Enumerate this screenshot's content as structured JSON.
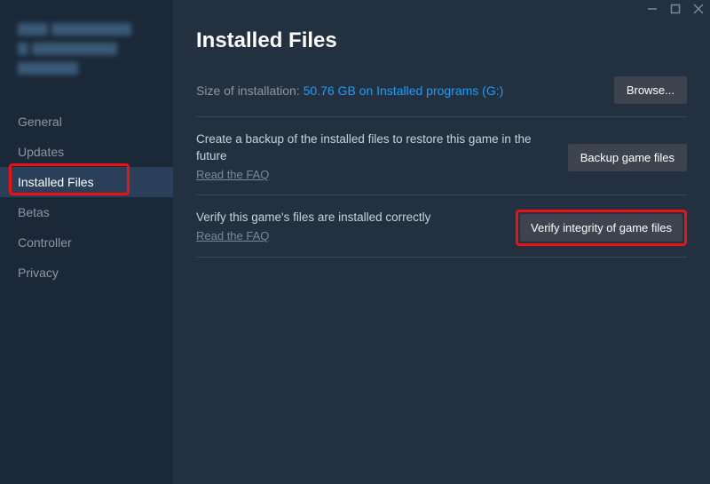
{
  "sidebar": {
    "items": [
      {
        "label": "General"
      },
      {
        "label": "Updates"
      },
      {
        "label": "Installed Files"
      },
      {
        "label": "Betas"
      },
      {
        "label": "Controller"
      },
      {
        "label": "Privacy"
      }
    ]
  },
  "main": {
    "title": "Installed Files",
    "size_label": "Size of installation: ",
    "size_value": "50.76 GB on Installed programs (G:)",
    "browse_btn": "Browse...",
    "backup": {
      "text": "Create a backup of the installed files to restore this game in the future",
      "faq": "Read the FAQ",
      "btn": "Backup game files"
    },
    "verify": {
      "text": "Verify this game's files are installed correctly",
      "faq": "Read the FAQ",
      "btn": "Verify integrity of game files"
    }
  }
}
